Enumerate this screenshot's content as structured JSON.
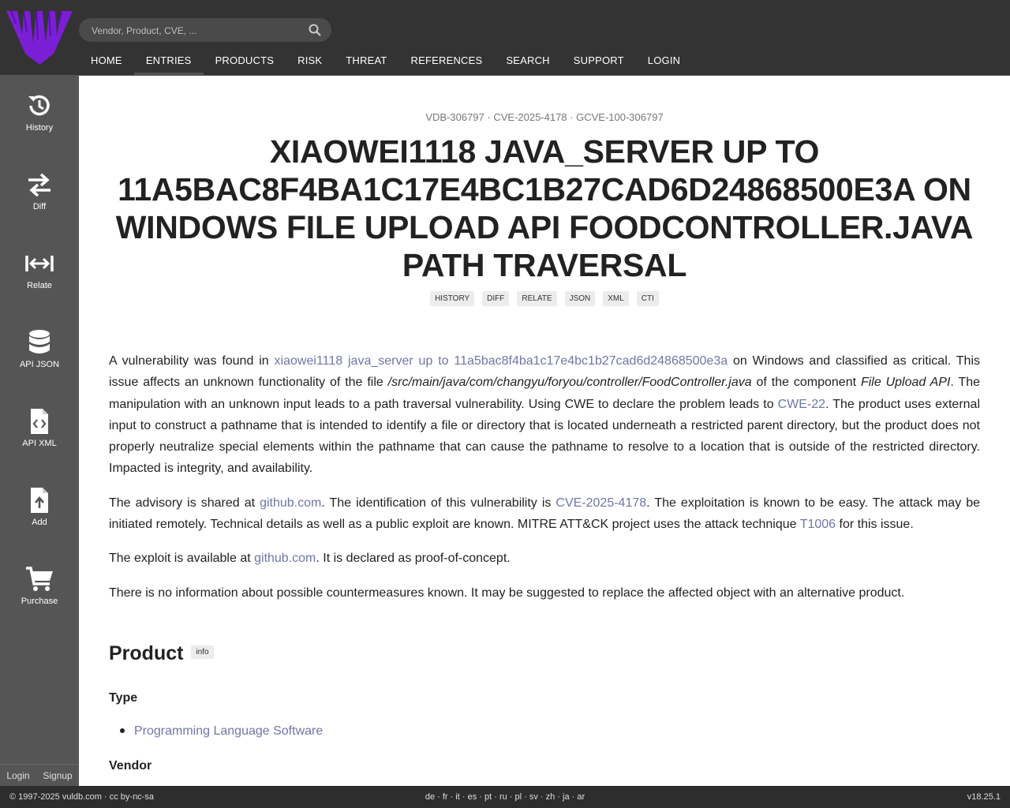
{
  "header": {
    "search_placeholder": "Vendor, Product, CVE, ...",
    "nav": [
      "HOME",
      "ENTRIES",
      "PRODUCTS",
      "RISK",
      "THREAT",
      "REFERENCES",
      "SEARCH",
      "SUPPORT",
      "LOGIN"
    ],
    "active_nav": "ENTRIES"
  },
  "sidebar": {
    "items": [
      {
        "label": "History",
        "icon": "history-icon"
      },
      {
        "label": "Diff",
        "icon": "swap-icon"
      },
      {
        "label": "Relate",
        "icon": "relate-icon"
      },
      {
        "label": "API JSON",
        "icon": "database-icon"
      },
      {
        "label": "API XML",
        "icon": "code-file-icon"
      },
      {
        "label": "Add",
        "icon": "upload-file-icon"
      },
      {
        "label": "Purchase",
        "icon": "cart-icon"
      }
    ],
    "login": "Login",
    "signup": "Signup"
  },
  "entry": {
    "ids": "VDB-306797 · CVE-2025-4178 · GCVE-100-306797",
    "title": "XIAOWEI1118 JAVA_SERVER UP TO 11A5BAC8F4BA1C17E4BC1B27CAD6D24868500E3A ON WINDOWS FILE UPLOAD API FOODCONTROLLER.JAVA PATH TRAVERSAL",
    "tags": [
      "HISTORY",
      "DIFF",
      "RELATE",
      "JSON",
      "XML",
      "CTI"
    ]
  },
  "paragraphs": {
    "p1": {
      "t1": "A vulnerability was found in ",
      "link1": "xiaowei1118 java_server up to 11a5bac8f4ba1c17e4bc1b27cad6d24868500e3a",
      "t2": " on Windows and classified as critical. This issue affects an unknown functionality of the file ",
      "file": "/src/main/java/com/changyu/foryou/controller/FoodController.java",
      "t3": " of the component ",
      "component": "File Upload API",
      "t4": ". The manipulation with an unknown input leads to a path traversal vulnerability. Using CWE to declare the problem leads to ",
      "link2": "CWE-22",
      "t5": ". The product uses external input to construct a pathname that is intended to identify a file or directory that is located underneath a restricted parent directory, but the product does not properly neutralize special elements within the pathname that can cause the pathname to resolve to a location that is outside of the restricted directory. Impacted is integrity, and availability."
    },
    "p2": {
      "t1": "The advisory is shared at ",
      "link1": "github.com",
      "t2": ". The identification of this vulnerability is ",
      "link2": "CVE-2025-4178",
      "t3": ". The exploitation is known to be easy. The attack may be initiated remotely. Technical details as well as a public exploit are known. MITRE ATT&CK project uses the attack technique ",
      "link3": "T1006",
      "t4": " for this issue."
    },
    "p3": {
      "t1": "The exploit is available at ",
      "link1": "github.com",
      "t2": ". It is declared as proof-of-concept."
    },
    "p4": "There is no information about possible countermeasures known. It may be suggested to replace the affected object with an alternative product."
  },
  "product": {
    "heading": "Product",
    "info": "info",
    "type_label": "Type",
    "type_value": "Programming Language Software",
    "vendor_label": "Vendor"
  },
  "footer": {
    "copyright": "© 1997-2025 vuldb.com · cc by-nc-sa",
    "languages": "de · fr · it · es · pt · ru · pl · sv · zh · ja · ar",
    "version": "v18.25.1"
  },
  "colors": {
    "topbar": "#333333",
    "sidebar": "#555555",
    "link": "#6e76a8",
    "logo": "#7a1fd6"
  }
}
